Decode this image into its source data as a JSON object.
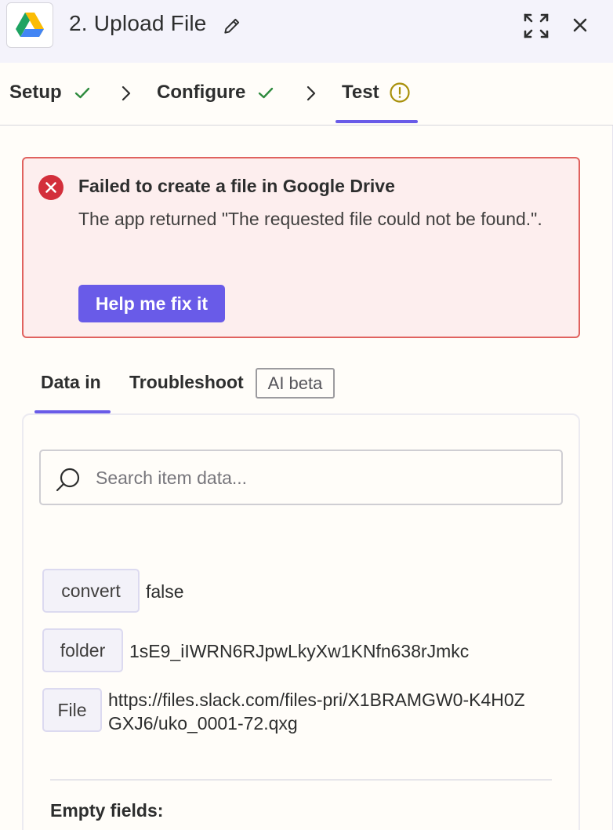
{
  "header": {
    "title": "2. Upload File",
    "app_icon": "google-drive-logo",
    "icons": [
      "edit-icon",
      "expand-icon",
      "close-icon"
    ]
  },
  "steps": [
    {
      "label": "Setup",
      "status": "complete"
    },
    {
      "label": "Configure",
      "status": "complete"
    },
    {
      "label": "Test",
      "status": "warning",
      "active": true
    }
  ],
  "error": {
    "title": "Failed to create a file in Google Drive",
    "message": "The app returned \"The requested file could not be found.\".",
    "button_label": "Help me fix it"
  },
  "data_tabs": {
    "data_in": "Data in",
    "troubleshoot": "Troubleshoot",
    "ai_badge": "AI beta"
  },
  "search": {
    "placeholder": "Search item data..."
  },
  "fields": [
    {
      "key": "convert",
      "value": "false"
    },
    {
      "key": "folder",
      "value": "1sE9_iIWRN6RJpwLkyXw1KNfn638rJmkc"
    },
    {
      "key": "File",
      "value": "https://files.slack.com/files-pri/X1BRAMGW0-K4H0ZGXJ6/uko_0001-72.qxg"
    }
  ],
  "empty_fields_label": "Empty fields:",
  "colors": {
    "accent": "#695be8",
    "success": "#2e8b3e",
    "warning": "#a8900a",
    "error": "#d32f3b",
    "error_bg": "#fdeeee"
  }
}
